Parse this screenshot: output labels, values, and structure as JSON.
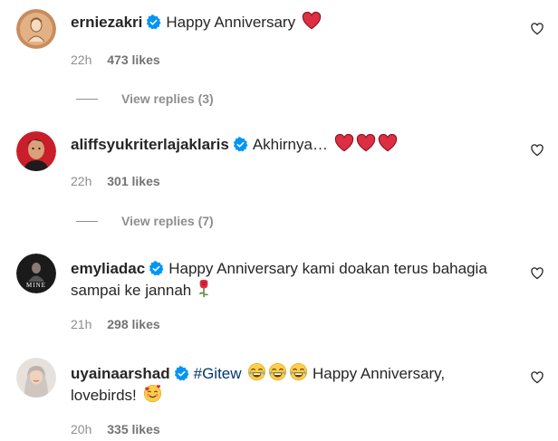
{
  "comments": [
    {
      "username": "erniezakri",
      "text": "Happy Anniversary",
      "time": "22h",
      "likes": "473 likes",
      "replies": "View replies (3)",
      "emojis": [
        "red-heart"
      ]
    },
    {
      "username": "aliffsyukriterlajaklaris",
      "text": "Akhirnya…",
      "time": "22h",
      "likes": "301 likes",
      "replies": "View replies (7)",
      "emojis": [
        "red-heart",
        "red-heart",
        "red-heart"
      ]
    },
    {
      "username": "emyliadac",
      "text": "Happy Anniversary kami doakan terus bahagia",
      "text_line2": "sampai ke jannah",
      "time": "21h",
      "likes": "298 likes",
      "emojis": [
        "rose"
      ]
    },
    {
      "username": "uyainaarshad",
      "hashtag": "#Gitew",
      "text": "Happy Anniversary,",
      "text_line2": "lovebirds!",
      "time": "20h",
      "likes": "335 likes",
      "emojis": [
        "tears-of-joy",
        "tears-of-joy",
        "tears-of-joy",
        "smiling-face-with-hearts"
      ]
    }
  ],
  "colors": {
    "text": "#262626",
    "meta": "#8e8e8e",
    "verified": "#0095f6",
    "hashtag": "#00376b",
    "heart": "#e0245e"
  }
}
